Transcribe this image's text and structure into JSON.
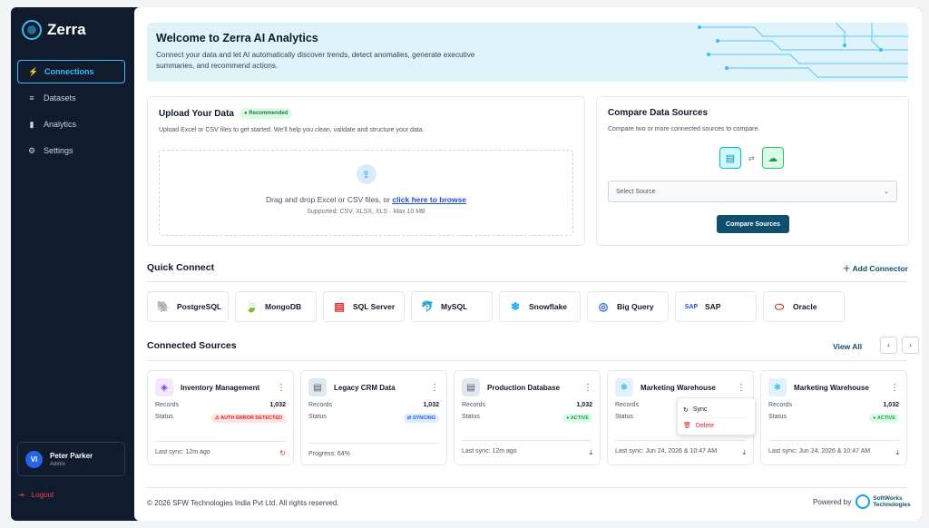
{
  "app": {
    "name": "Zerra"
  },
  "sidebar": {
    "items": [
      {
        "label": "Connections",
        "icon": "bolt-icon"
      },
      {
        "label": "Datasets",
        "icon": "database-icon"
      },
      {
        "label": "Analytics",
        "icon": "bar-chart-icon"
      },
      {
        "label": "Settings",
        "icon": "gear-icon"
      }
    ],
    "user": {
      "initials": "VI",
      "name": "Peter Parker",
      "role": "Admin"
    },
    "logout": "Logout"
  },
  "welcome": {
    "title": "Welcome to Zerra AI Analytics",
    "text": "Connect your data and let AI automatically discover trends, detect anomalies, generate executive summaries, and recommend actions."
  },
  "upload": {
    "title": "Upload Your Data",
    "badge": "Recommended",
    "subtitle": "Upload Excel or CSV files to get started. We'll help you clean, validate and structure your data.",
    "drop_text": "Drag and drop Excel or CSV files, or ",
    "drop_link": "click here to browse",
    "supported": "Supported: CSV, XLSX, XLS · Max 10 MB"
  },
  "compare": {
    "title": "Compare Data Sources",
    "subtitle": "Compare two or more connected sources to compare.",
    "select_placeholder": "Select Source",
    "button": "Compare Sources"
  },
  "quick_connect": {
    "title": "Quick Connect",
    "add_label": "Add Connector",
    "items": [
      {
        "label": "PostgreSQL",
        "glyph": "🐘"
      },
      {
        "label": "MongoDB",
        "glyph": "🍃"
      },
      {
        "label": "SQL Server",
        "glyph": "▤"
      },
      {
        "label": "MySQL",
        "glyph": "🐬"
      },
      {
        "label": "Snowflake",
        "glyph": "❄"
      },
      {
        "label": "Big Query",
        "glyph": "◎"
      },
      {
        "label": "SAP",
        "glyph": "SAP"
      },
      {
        "label": "Oracle",
        "glyph": "⬭"
      }
    ]
  },
  "connected": {
    "title": "Connected Sources",
    "view_all": "View All",
    "records_label": "Records",
    "status_label": "Status",
    "sources": [
      {
        "name": "Inventory Management",
        "records": "1,032",
        "status": "AUTH ERROR DETECTED",
        "status_type": "err",
        "footer": "Last sync: 12m ago",
        "icon": "cube-icon"
      },
      {
        "name": "Legacy CRM Data",
        "records": "1,032",
        "status": "SYNCING",
        "status_type": "sync",
        "footer": "Progress: 64%",
        "icon": "server-icon"
      },
      {
        "name": "Production Database",
        "records": "1,032",
        "status": "ACTIVE",
        "status_type": "active",
        "footer": "Last sync: 12m ago",
        "icon": "server-icon"
      },
      {
        "name": "Marketing Warehouse",
        "records": "",
        "status": "",
        "status_type": "",
        "footer": "Last sync: Jun 24, 2026 & 10:47 AM",
        "icon": "snowflake-icon"
      },
      {
        "name": "Marketing Warehouse",
        "records": "1,032",
        "status": "ACTIVE",
        "status_type": "active",
        "footer": "Last sync: Jun 24, 2026 & 10:47 AM",
        "icon": "snowflake-icon"
      }
    ],
    "menu": {
      "sync": "Sync",
      "delete": "Delete"
    }
  },
  "footer": {
    "copyright": "© 2026 SFW Technologies India Pvt Ltd. All rights reserved.",
    "powered_by": "Powered by",
    "brand_line1": "SoftWorks",
    "brand_line2": "Technologies"
  }
}
